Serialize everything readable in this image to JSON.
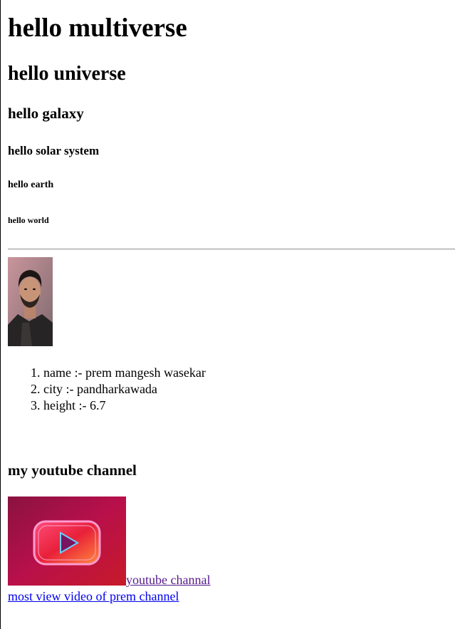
{
  "headings": {
    "h1": "hello multiverse",
    "h2": "hello universe",
    "h3": "hello galaxy",
    "h4": "hello solar system",
    "h5": "hello earth",
    "h6": "hello world"
  },
  "profile_list": [
    "name :- prem mangesh wasekar",
    "city :- pandharkawada",
    "height :- 6.7"
  ],
  "youtube": {
    "heading": "my youtube channel",
    "channel_link": "youtube channal",
    "video_link": "most view video of prem channel"
  },
  "colors": {
    "visited_link": "#551a8b",
    "link": "#0000ee"
  }
}
